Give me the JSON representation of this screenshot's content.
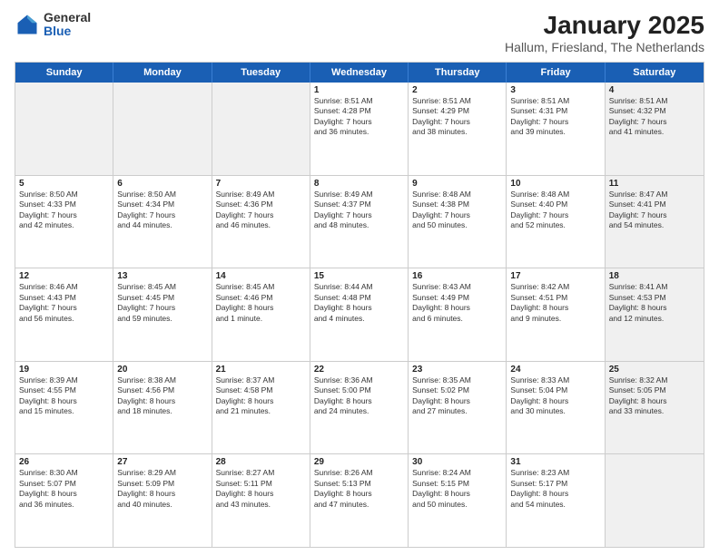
{
  "logo": {
    "general": "General",
    "blue": "Blue"
  },
  "title": "January 2025",
  "subtitle": "Hallum, Friesland, The Netherlands",
  "header_days": [
    "Sunday",
    "Monday",
    "Tuesday",
    "Wednesday",
    "Thursday",
    "Friday",
    "Saturday"
  ],
  "weeks": [
    [
      {
        "day": "",
        "shaded": true,
        "lines": []
      },
      {
        "day": "",
        "shaded": true,
        "lines": []
      },
      {
        "day": "",
        "shaded": true,
        "lines": []
      },
      {
        "day": "1",
        "shaded": false,
        "lines": [
          "Sunrise: 8:51 AM",
          "Sunset: 4:28 PM",
          "Daylight: 7 hours",
          "and 36 minutes."
        ]
      },
      {
        "day": "2",
        "shaded": false,
        "lines": [
          "Sunrise: 8:51 AM",
          "Sunset: 4:29 PM",
          "Daylight: 7 hours",
          "and 38 minutes."
        ]
      },
      {
        "day": "3",
        "shaded": false,
        "lines": [
          "Sunrise: 8:51 AM",
          "Sunset: 4:31 PM",
          "Daylight: 7 hours",
          "and 39 minutes."
        ]
      },
      {
        "day": "4",
        "shaded": true,
        "lines": [
          "Sunrise: 8:51 AM",
          "Sunset: 4:32 PM",
          "Daylight: 7 hours",
          "and 41 minutes."
        ]
      }
    ],
    [
      {
        "day": "5",
        "shaded": false,
        "lines": [
          "Sunrise: 8:50 AM",
          "Sunset: 4:33 PM",
          "Daylight: 7 hours",
          "and 42 minutes."
        ]
      },
      {
        "day": "6",
        "shaded": false,
        "lines": [
          "Sunrise: 8:50 AM",
          "Sunset: 4:34 PM",
          "Daylight: 7 hours",
          "and 44 minutes."
        ]
      },
      {
        "day": "7",
        "shaded": false,
        "lines": [
          "Sunrise: 8:49 AM",
          "Sunset: 4:36 PM",
          "Daylight: 7 hours",
          "and 46 minutes."
        ]
      },
      {
        "day": "8",
        "shaded": false,
        "lines": [
          "Sunrise: 8:49 AM",
          "Sunset: 4:37 PM",
          "Daylight: 7 hours",
          "and 48 minutes."
        ]
      },
      {
        "day": "9",
        "shaded": false,
        "lines": [
          "Sunrise: 8:48 AM",
          "Sunset: 4:38 PM",
          "Daylight: 7 hours",
          "and 50 minutes."
        ]
      },
      {
        "day": "10",
        "shaded": false,
        "lines": [
          "Sunrise: 8:48 AM",
          "Sunset: 4:40 PM",
          "Daylight: 7 hours",
          "and 52 minutes."
        ]
      },
      {
        "day": "11",
        "shaded": true,
        "lines": [
          "Sunrise: 8:47 AM",
          "Sunset: 4:41 PM",
          "Daylight: 7 hours",
          "and 54 minutes."
        ]
      }
    ],
    [
      {
        "day": "12",
        "shaded": false,
        "lines": [
          "Sunrise: 8:46 AM",
          "Sunset: 4:43 PM",
          "Daylight: 7 hours",
          "and 56 minutes."
        ]
      },
      {
        "day": "13",
        "shaded": false,
        "lines": [
          "Sunrise: 8:45 AM",
          "Sunset: 4:45 PM",
          "Daylight: 7 hours",
          "and 59 minutes."
        ]
      },
      {
        "day": "14",
        "shaded": false,
        "lines": [
          "Sunrise: 8:45 AM",
          "Sunset: 4:46 PM",
          "Daylight: 8 hours",
          "and 1 minute."
        ]
      },
      {
        "day": "15",
        "shaded": false,
        "lines": [
          "Sunrise: 8:44 AM",
          "Sunset: 4:48 PM",
          "Daylight: 8 hours",
          "and 4 minutes."
        ]
      },
      {
        "day": "16",
        "shaded": false,
        "lines": [
          "Sunrise: 8:43 AM",
          "Sunset: 4:49 PM",
          "Daylight: 8 hours",
          "and 6 minutes."
        ]
      },
      {
        "day": "17",
        "shaded": false,
        "lines": [
          "Sunrise: 8:42 AM",
          "Sunset: 4:51 PM",
          "Daylight: 8 hours",
          "and 9 minutes."
        ]
      },
      {
        "day": "18",
        "shaded": true,
        "lines": [
          "Sunrise: 8:41 AM",
          "Sunset: 4:53 PM",
          "Daylight: 8 hours",
          "and 12 minutes."
        ]
      }
    ],
    [
      {
        "day": "19",
        "shaded": false,
        "lines": [
          "Sunrise: 8:39 AM",
          "Sunset: 4:55 PM",
          "Daylight: 8 hours",
          "and 15 minutes."
        ]
      },
      {
        "day": "20",
        "shaded": false,
        "lines": [
          "Sunrise: 8:38 AM",
          "Sunset: 4:56 PM",
          "Daylight: 8 hours",
          "and 18 minutes."
        ]
      },
      {
        "day": "21",
        "shaded": false,
        "lines": [
          "Sunrise: 8:37 AM",
          "Sunset: 4:58 PM",
          "Daylight: 8 hours",
          "and 21 minutes."
        ]
      },
      {
        "day": "22",
        "shaded": false,
        "lines": [
          "Sunrise: 8:36 AM",
          "Sunset: 5:00 PM",
          "Daylight: 8 hours",
          "and 24 minutes."
        ]
      },
      {
        "day": "23",
        "shaded": false,
        "lines": [
          "Sunrise: 8:35 AM",
          "Sunset: 5:02 PM",
          "Daylight: 8 hours",
          "and 27 minutes."
        ]
      },
      {
        "day": "24",
        "shaded": false,
        "lines": [
          "Sunrise: 8:33 AM",
          "Sunset: 5:04 PM",
          "Daylight: 8 hours",
          "and 30 minutes."
        ]
      },
      {
        "day": "25",
        "shaded": true,
        "lines": [
          "Sunrise: 8:32 AM",
          "Sunset: 5:05 PM",
          "Daylight: 8 hours",
          "and 33 minutes."
        ]
      }
    ],
    [
      {
        "day": "26",
        "shaded": false,
        "lines": [
          "Sunrise: 8:30 AM",
          "Sunset: 5:07 PM",
          "Daylight: 8 hours",
          "and 36 minutes."
        ]
      },
      {
        "day": "27",
        "shaded": false,
        "lines": [
          "Sunrise: 8:29 AM",
          "Sunset: 5:09 PM",
          "Daylight: 8 hours",
          "and 40 minutes."
        ]
      },
      {
        "day": "28",
        "shaded": false,
        "lines": [
          "Sunrise: 8:27 AM",
          "Sunset: 5:11 PM",
          "Daylight: 8 hours",
          "and 43 minutes."
        ]
      },
      {
        "day": "29",
        "shaded": false,
        "lines": [
          "Sunrise: 8:26 AM",
          "Sunset: 5:13 PM",
          "Daylight: 8 hours",
          "and 47 minutes."
        ]
      },
      {
        "day": "30",
        "shaded": false,
        "lines": [
          "Sunrise: 8:24 AM",
          "Sunset: 5:15 PM",
          "Daylight: 8 hours",
          "and 50 minutes."
        ]
      },
      {
        "day": "31",
        "shaded": false,
        "lines": [
          "Sunrise: 8:23 AM",
          "Sunset: 5:17 PM",
          "Daylight: 8 hours",
          "and 54 minutes."
        ]
      },
      {
        "day": "",
        "shaded": true,
        "lines": []
      }
    ]
  ]
}
